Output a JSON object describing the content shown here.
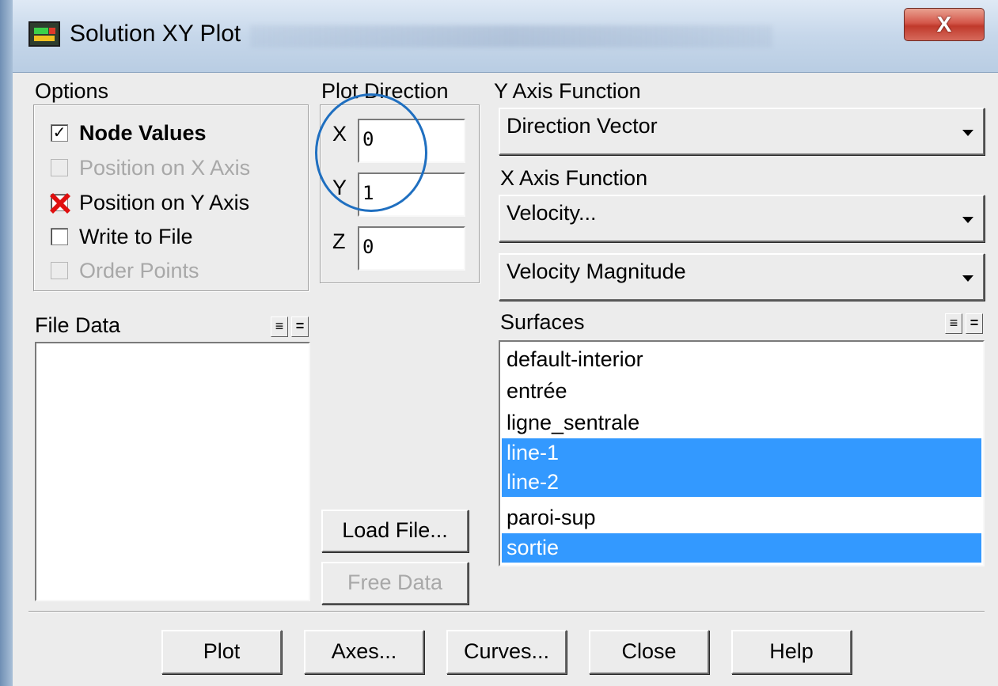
{
  "window": {
    "title": "Solution XY Plot",
    "close_label": "X"
  },
  "options": {
    "label": "Options",
    "items": [
      {
        "label": "Node Values",
        "checked": true,
        "enabled": true
      },
      {
        "label": "Position on X Axis",
        "checked": false,
        "enabled": false
      },
      {
        "label": "Position on Y Axis",
        "checked": true,
        "enabled": true
      },
      {
        "label": "Write to File",
        "checked": false,
        "enabled": true
      },
      {
        "label": "Order Points",
        "checked": false,
        "enabled": false
      }
    ]
  },
  "plot_direction": {
    "label": "Plot Direction",
    "x_label": "X",
    "x_value": "0",
    "y_label": "Y",
    "y_value": "1",
    "z_label": "Z",
    "z_value": "0"
  },
  "y_axis": {
    "label": "Y Axis Function",
    "value": "Direction Vector"
  },
  "x_axis": {
    "label": "X Axis Function",
    "category": "Velocity...",
    "value": "Velocity Magnitude"
  },
  "file_data": {
    "label": "File Data",
    "select_all_icon": "select-all-icon",
    "deselect_all_icon": "deselect-all-icon"
  },
  "surfaces": {
    "label": "Surfaces",
    "items": [
      {
        "label": "default-interior",
        "selected": false
      },
      {
        "label": "entrée",
        "selected": false
      },
      {
        "label": "ligne_sentrale",
        "selected": false
      },
      {
        "label": "line-1",
        "selected": true
      },
      {
        "label": "line-2",
        "selected": true
      },
      {
        "label": "paroi-sup",
        "selected": false
      },
      {
        "label": "sortie",
        "selected": true
      }
    ]
  },
  "buttons": {
    "load_file": "Load File...",
    "free_data": "Free Data",
    "plot": "Plot",
    "axes": "Axes...",
    "curves": "Curves...",
    "close": "Close",
    "help": "Help"
  },
  "colors": {
    "selection": "#3399ff",
    "annotation": "#1f6fc0",
    "error_mark": "#e01010"
  }
}
